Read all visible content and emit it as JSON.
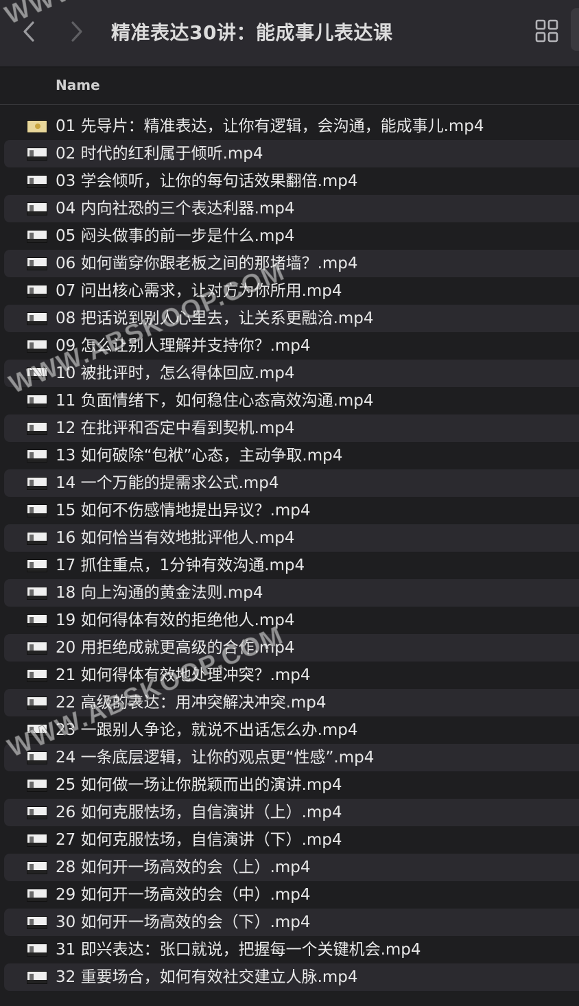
{
  "window": {
    "title": "精准表达30讲：能成事儿表达课",
    "back_icon": "chevron-left-icon",
    "forward_icon": "chevron-right-icon",
    "view_icon": "grid-view-icon"
  },
  "table": {
    "column_name": "Name"
  },
  "files": [
    "01 先导片：精准表达，让你有逻辑，会沟通，能成事儿.mp4",
    "02 时代的红利属于倾听.mp4",
    "03 学会倾听，让你的每句话效果翻倍.mp4",
    "04 内向社恐的三个表达利器.mp4",
    "05 闷头做事的前一步是什么.mp4",
    "06 如何凿穿你跟老板之间的那堵墙？.mp4",
    "07 问出核心需求，让对方为你所用.mp4",
    "08 把话说到别人心里去，让关系更融洽.mp4",
    "09 怎么让别人理解并支持你？.mp4",
    "10 被批评时，怎么得体回应.mp4",
    "11 负面情绪下，如何稳住心态高效沟通.mp4",
    "12 在批评和否定中看到契机.mp4",
    "13 如何破除“包袱”心态，主动争取.mp4",
    "14 一个万能的提需求公式.mp4",
    "15 如何不伤感情地提出异议？.mp4",
    "16 如何恰当有效地批评他人.mp4",
    "17 抓住重点，1分钟有效沟通.mp4",
    "18 向上沟通的黄金法则.mp4",
    "19 如何得体有效的拒绝他人.mp4",
    "20 用拒绝成就更高级的合作.mp4",
    "21 如何得体有效地处理冲突？.mp4",
    "22 高级的表达：用冲突解决冲突.mp4",
    "23 一跟别人争论，就说不出话怎么办.mp4",
    "24 一条底层逻辑，让你的观点更“性感”.mp4",
    "25 如何做一场让你脱颖而出的演讲.mp4",
    "26 如何克服怯场，自信演讲（上）.mp4",
    "27 如何克服怯场，自信演讲（下）.mp4",
    "28 如何开一场高效的会（上）.mp4",
    "29 如何开一场高效的会（中）.mp4",
    "30 如何开一场高效的会（下）.mp4",
    "31 即兴表达：张口就说，把握每一个关键机会.mp4",
    "32 重要场合，如何有效社交建立人脉.mp4"
  ],
  "watermarks": {
    "text_1": "WWW.ABSKOOP.COM",
    "text_2": "WWW.ABSKOOP.COM",
    "text_top": "WWW."
  },
  "colors": {
    "background": "#1e1e20",
    "toolbar": "#2b2a2f",
    "row_alt": "#2b2a2f",
    "text": "#e8e8e8"
  }
}
